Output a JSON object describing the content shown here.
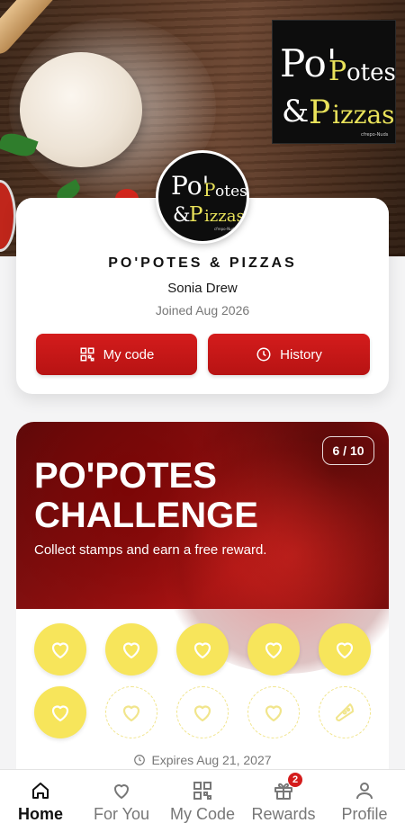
{
  "brand": {
    "logo_text_top": "Po'Potes",
    "logo_text_bottom": "& Pizzas",
    "logo_subtext": "cfrepo-Nuds",
    "name": "PO'POTES & PIZZAS"
  },
  "profile": {
    "user_name": "Sonia Drew",
    "joined": "Joined Aug 2026",
    "my_code_label": "My code",
    "history_label": "History"
  },
  "challenge": {
    "progress": "6 / 10",
    "stamps_collected": 6,
    "stamps_total": 10,
    "title_line1": "PO'POTES",
    "title_line2": "CHALLENGE",
    "description": "Collect stamps and earn a free reward.",
    "expires": "Expires Aug 21, 2027"
  },
  "nav": {
    "items": [
      {
        "label": "Home",
        "icon": "home-icon",
        "active": true
      },
      {
        "label": "For You",
        "icon": "heart-icon",
        "active": false
      },
      {
        "label": "My Code",
        "icon": "qr-code-icon",
        "active": false
      },
      {
        "label": "Rewards",
        "icon": "gift-icon",
        "active": false,
        "badge": "2"
      },
      {
        "label": "Profile",
        "icon": "user-icon",
        "active": false
      }
    ]
  },
  "colors": {
    "accent": "#d41c1c",
    "stamp_filled": "#f7e55b",
    "logo_yellow": "#e9e25a"
  }
}
